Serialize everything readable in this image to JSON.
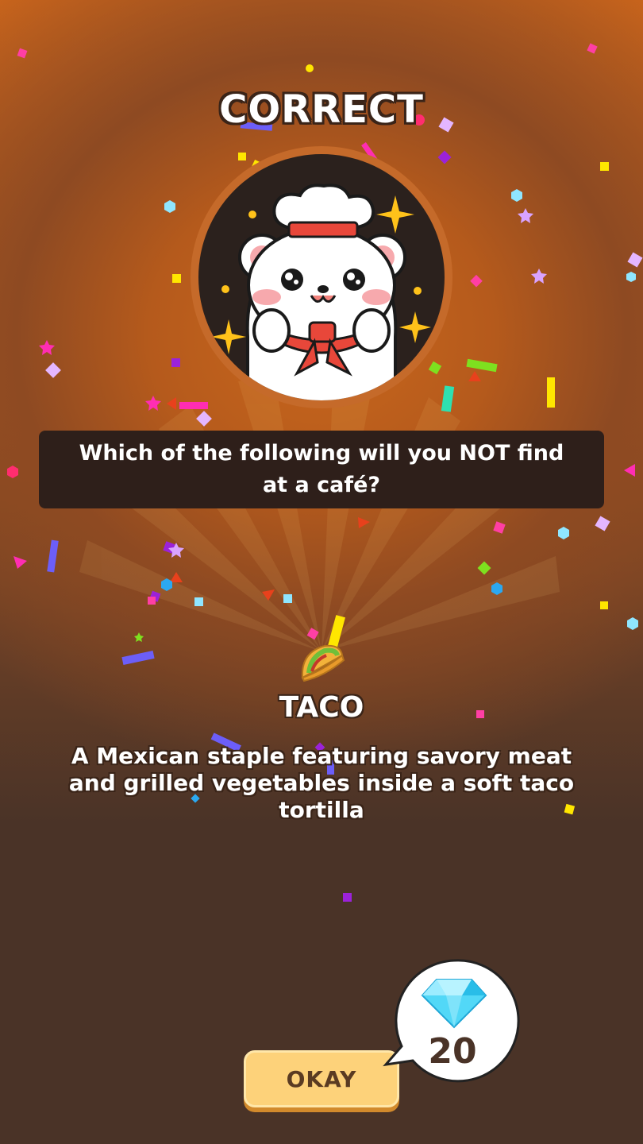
{
  "result": {
    "title": "CORRECT"
  },
  "question": {
    "text": "Which of the following will you NOT find at a café?"
  },
  "answer": {
    "icon": "taco-icon",
    "name": "TACO",
    "description": "A Mexican staple featuring savory meat and grilled vegetables inside a soft taco tortilla"
  },
  "reward": {
    "icon": "diamond-gem-icon",
    "amount": "20"
  },
  "actions": {
    "okay_label": "OKAY"
  },
  "colors": {
    "accent_orange": "#c8641c",
    "panel_dark": "#2e1f1a",
    "button_yellow": "#fdd27a",
    "background_brown": "#4a3327"
  }
}
